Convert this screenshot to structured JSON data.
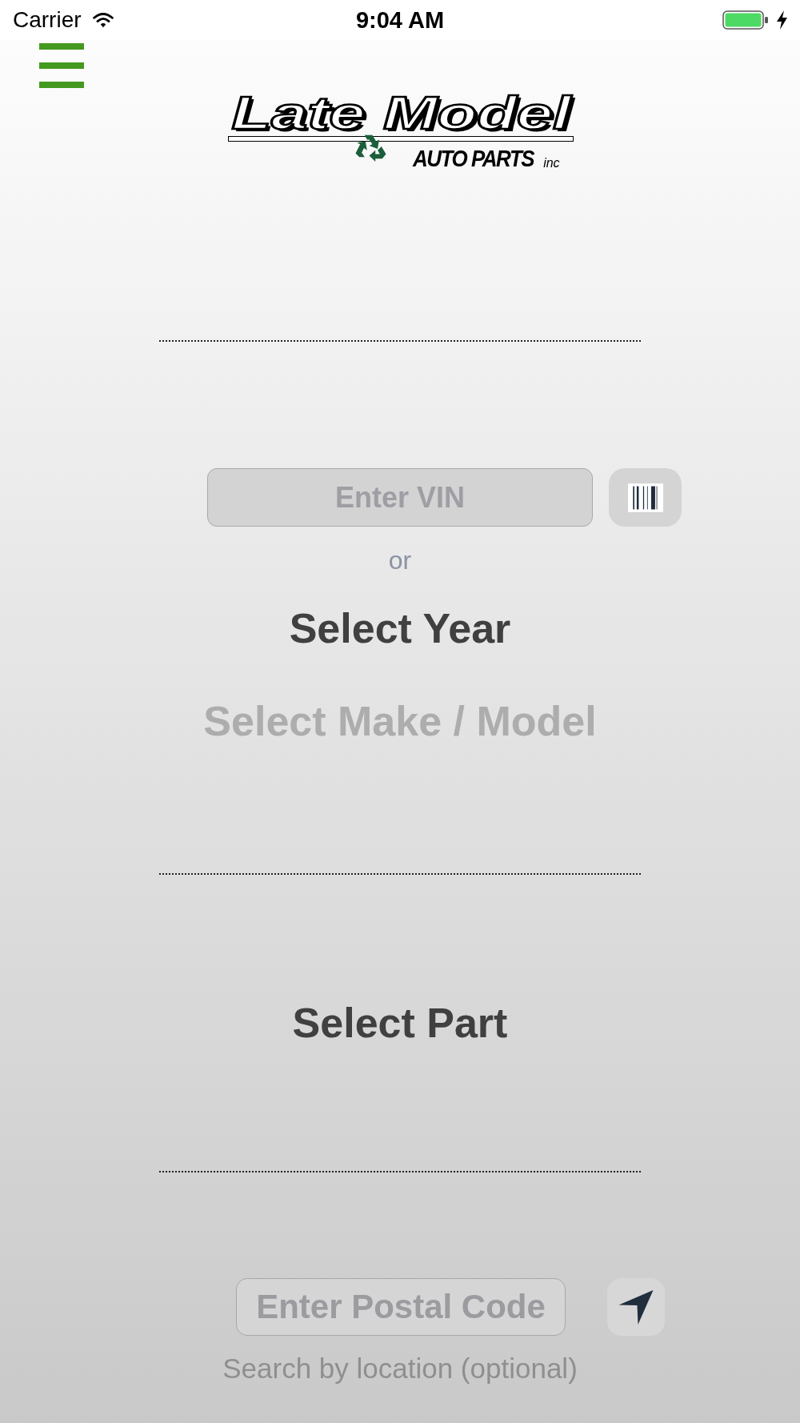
{
  "status_bar": {
    "carrier": "Carrier",
    "time": "9:04 AM"
  },
  "header": {
    "logo": {
      "title": "Late Model",
      "subtitle": "AUTO PARTS",
      "suffix": "inc"
    }
  },
  "vehicle": {
    "vin_field": {
      "placeholder": "Enter VIN"
    },
    "separator": "or",
    "selectors": [
      {
        "label": "Select Year",
        "disabled": false
      },
      {
        "label": "Select Make / Model",
        "disabled": true
      }
    ]
  },
  "part": {
    "selector": {
      "label": "Select Part",
      "disabled": false
    }
  },
  "location": {
    "postal_field": {
      "placeholder": "Enter Postal Code"
    },
    "hint": "Search by location (optional)"
  }
}
